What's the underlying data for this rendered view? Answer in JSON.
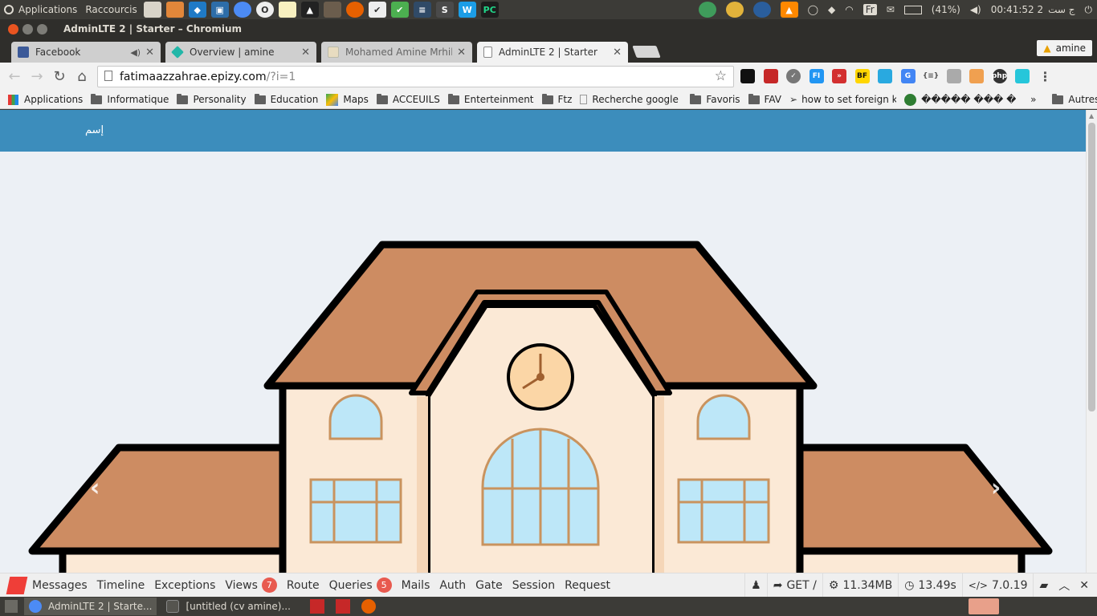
{
  "top_panel": {
    "apps_label": "Applications",
    "shortcuts_label": "Raccourcis",
    "battery": "(41%)",
    "clock": "00:41:52 2",
    "date_suffix": "ج ست",
    "keyboard_layout": "Fr"
  },
  "window": {
    "title": "AdminLTE 2 | Starter – Chromium"
  },
  "tabs": [
    {
      "label": "Facebook",
      "favicon_color": "#3b5998"
    },
    {
      "label": "Overview | amine",
      "favicon_color": "#22b7a8"
    },
    {
      "label": "Mohamed Amine Mrhili",
      "favicon_color": "#e8dcc0"
    },
    {
      "label": "AdminLTE 2 | Starter",
      "favicon_color": "#ffffff"
    }
  ],
  "profile": {
    "name": "amine"
  },
  "omnibox": {
    "host": "fatimaazzahrae.epizy.com",
    "path": "/?i=1"
  },
  "bookmarks": [
    {
      "label": "Applications",
      "icon": "apps-grid-icon"
    },
    {
      "label": "Informatique",
      "icon": "folder-icon"
    },
    {
      "label": "Personality",
      "icon": "folder-icon"
    },
    {
      "label": "Education",
      "icon": "folder-icon"
    },
    {
      "label": "Maps",
      "icon": "maps-icon"
    },
    {
      "label": "ACCEUILS",
      "icon": "folder-icon"
    },
    {
      "label": "Enterteinment",
      "icon": "folder-icon"
    },
    {
      "label": "Ftz",
      "icon": "folder-icon"
    },
    {
      "label": "Recherche google a t",
      "icon": "page-icon"
    },
    {
      "label": "Favoris",
      "icon": "folder-icon"
    },
    {
      "label": "FAV",
      "icon": "folder-icon"
    },
    {
      "label": "how to set foreign key",
      "icon": "link-icon"
    },
    {
      "label": "����� ��� ��",
      "icon": "globe-icon"
    }
  ],
  "bookmarks_overflow": "»",
  "other_bookmarks": "Autres favoris",
  "page": {
    "header_name": "إسم",
    "header_color": "#3c8dbc",
    "background": "#ecf0f5"
  },
  "debugbar": {
    "tabs": [
      {
        "label": "Messages"
      },
      {
        "label": "Timeline"
      },
      {
        "label": "Exceptions"
      },
      {
        "label": "Views",
        "badge": "7"
      },
      {
        "label": "Route"
      },
      {
        "label": "Queries",
        "badge": "5"
      },
      {
        "label": "Mails"
      },
      {
        "label": "Auth"
      },
      {
        "label": "Gate"
      },
      {
        "label": "Session"
      },
      {
        "label": "Request"
      }
    ],
    "request": "GET /",
    "memory": "11.34MB",
    "time": "13.49s",
    "php_version": "7.0.19"
  },
  "taskbar": {
    "items": [
      {
        "label": "AdminLTE 2 | Starte..."
      },
      {
        "label": "[untitled (cv amine)..."
      }
    ]
  }
}
